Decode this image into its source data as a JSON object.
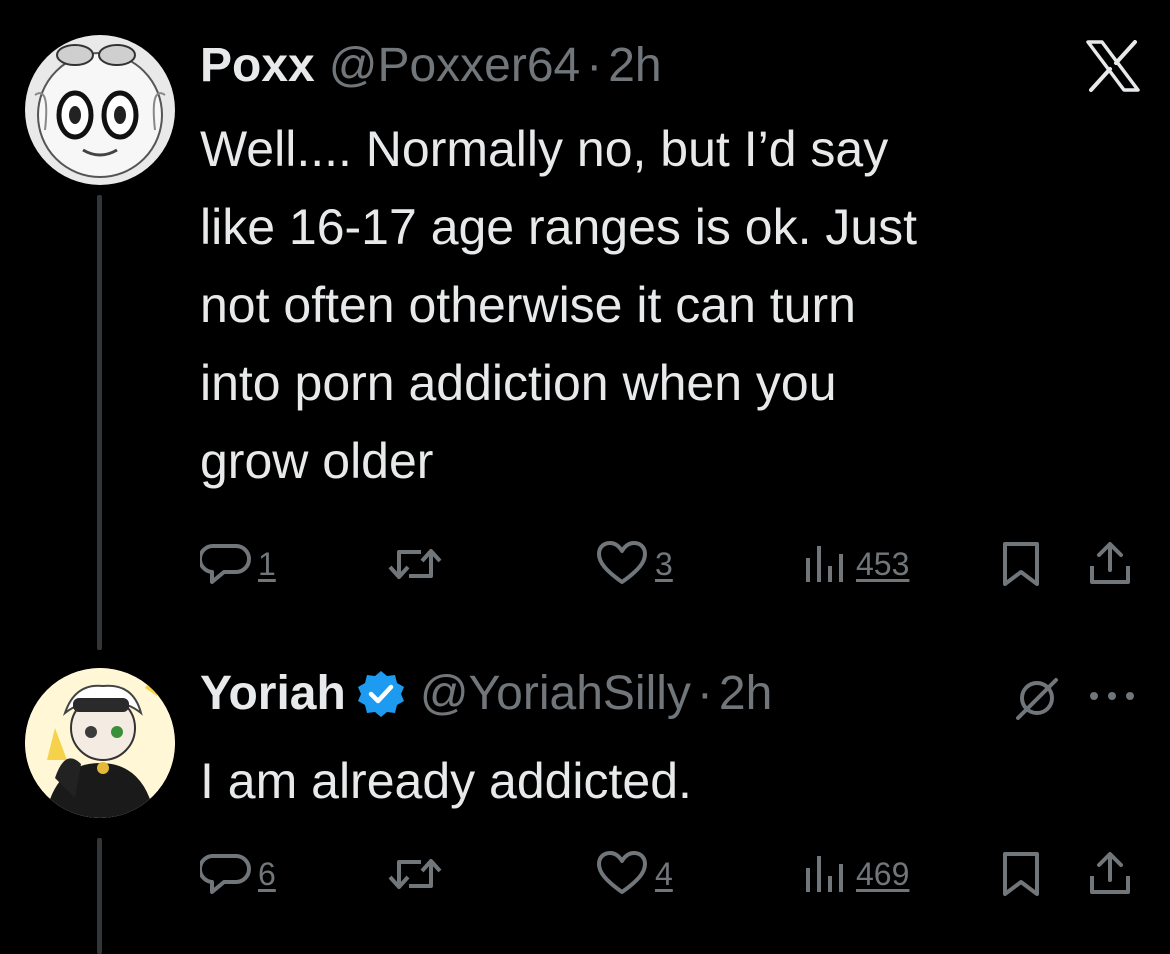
{
  "tweets": [
    {
      "display_name": "Poxx",
      "handle": "@Poxxer64",
      "separator": "·",
      "time": "2h",
      "verified": false,
      "corner_icon": "x-logo-icon",
      "text": "Well.... Normally no, but I’d say\nlike 16-17 age ranges is ok. Just\nnot often otherwise it can turn\ninto porn addiction when you\ngrow older",
      "actions": {
        "replies": "1",
        "retweets": "",
        "likes": "3",
        "views": "453"
      }
    },
    {
      "display_name": "Yoriah",
      "handle": "@YoriahSilly",
      "separator": "·",
      "time": "2h",
      "verified": true,
      "corner_icon": "grok-icon",
      "more_icon": "more-icon",
      "text": "I am already addicted.",
      "actions": {
        "replies": "6",
        "retweets": "",
        "likes": "4",
        "views": "469"
      }
    }
  ],
  "colors": {
    "background": "#000000",
    "text_primary": "#e7e9ea",
    "text_secondary": "#71767b",
    "verified_blue": "#1d9bf0",
    "thread_line": "#333639"
  }
}
